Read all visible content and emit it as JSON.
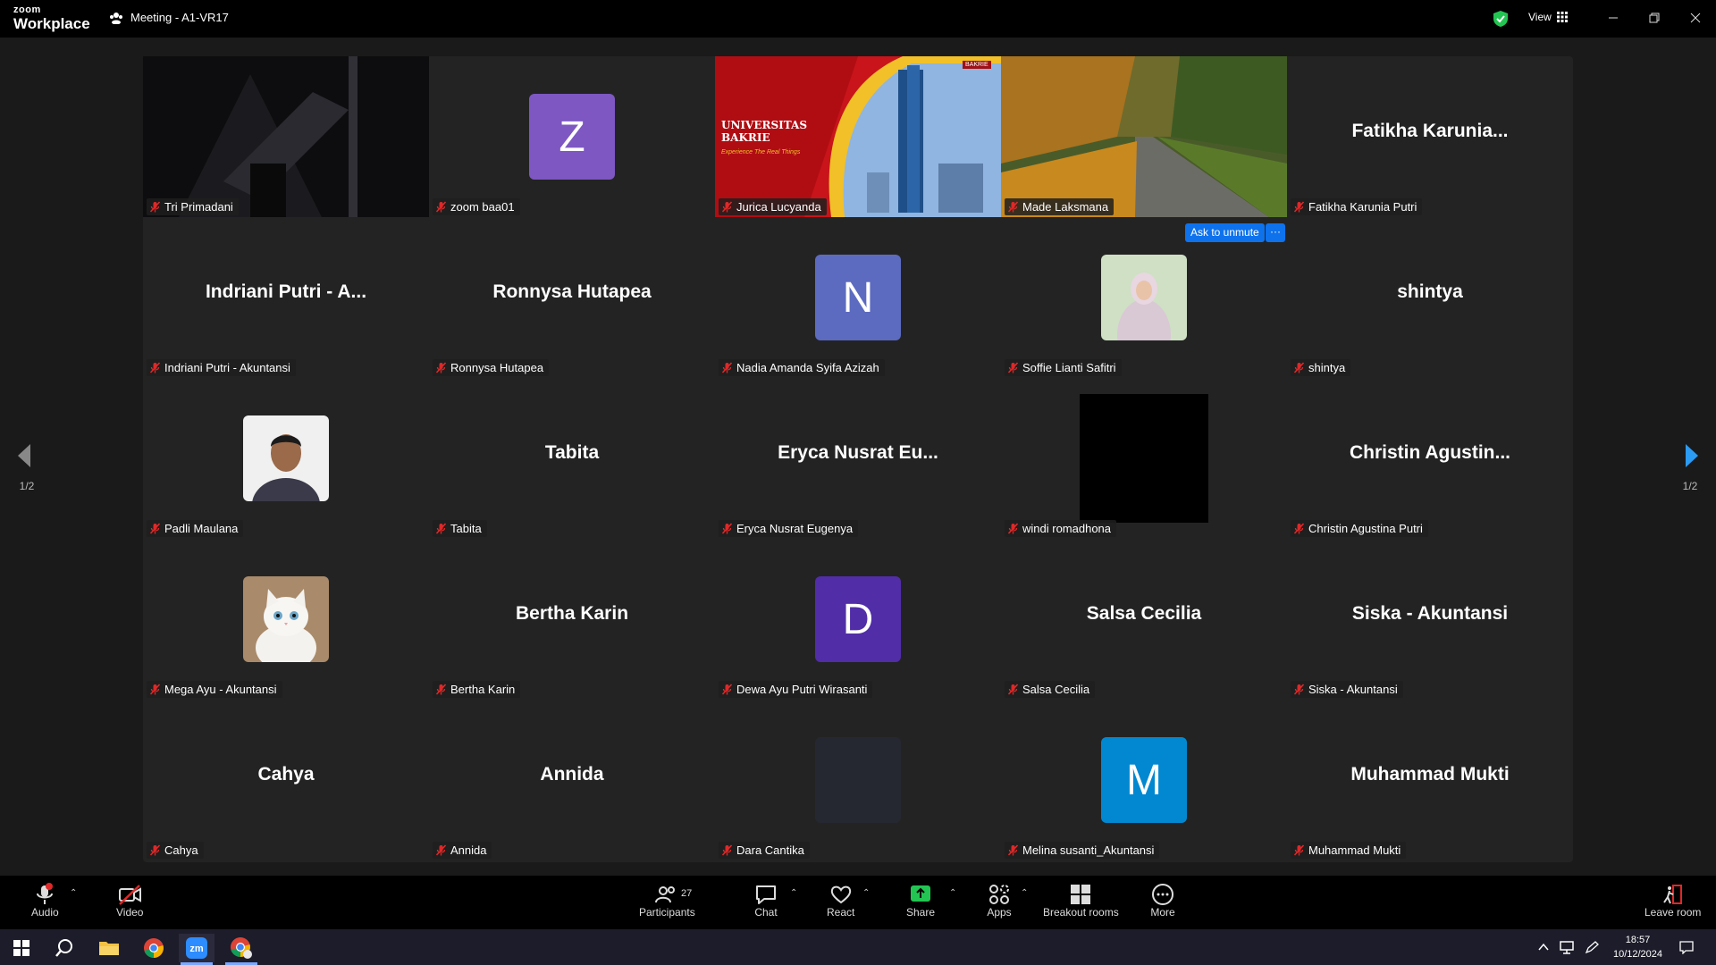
{
  "app": {
    "logo_top": "zoom",
    "logo_bottom": "Workplace",
    "meeting_title": "Meeting - A1-VR17",
    "view_label": "View"
  },
  "colors": {
    "accent": "#0e72ed",
    "highlight_border": "#23d18b",
    "mute_red": "#e02828"
  },
  "tiles": [
    {
      "display": "video",
      "name": "Tri Primadani"
    },
    {
      "display": "avatar",
      "avatar_letter": "Z",
      "avatar_color": "#7e57c2",
      "name": "zoom baa01"
    },
    {
      "display": "video-bakrie",
      "name": "Jurica Lucyanda",
      "banner_line1": "UNIVERSITAS",
      "banner_line2": "BAKRIE",
      "banner_tagline": "Experience The Real Things",
      "banner_badge": "BAKRIE"
    },
    {
      "display": "video-road",
      "name": "Made Laksmana"
    },
    {
      "display": "text",
      "center": "Fatikha  Karunia...",
      "name": "Fatikha Karunia Putri"
    },
    {
      "display": "text",
      "center": "Indriani Putri - A...",
      "name": "Indriani Putri - Akuntansi"
    },
    {
      "display": "text",
      "center": "Ronnysa Hutapea",
      "name": "Ronnysa Hutapea"
    },
    {
      "display": "avatar",
      "avatar_letter": "N",
      "avatar_color": "#5c6bc0",
      "name": "Nadia Amanda Syifa Azizah"
    },
    {
      "display": "photo-hijab",
      "name": "Soffie Lianti Safitri"
    },
    {
      "display": "text",
      "center": "shintya",
      "name": "shintya"
    },
    {
      "display": "photo-man",
      "name": "Padli Maulana"
    },
    {
      "display": "text",
      "center": "Tabita",
      "name": "Tabita"
    },
    {
      "display": "text",
      "center": "Eryca Nusrat Eu...",
      "name": "Eryca Nusrat Eugenya"
    },
    {
      "display": "black",
      "name": "windi romadhona"
    },
    {
      "display": "text",
      "center": "Christin  Agustin...",
      "name": "Christin Agustina Putri"
    },
    {
      "display": "photo-cat",
      "name": "Mega Ayu - Akuntansi"
    },
    {
      "display": "text",
      "center": "Bertha Karin",
      "name": "Bertha Karin"
    },
    {
      "display": "avatar",
      "avatar_letter": "D",
      "avatar_color": "#512da8",
      "name": "Dewa Ayu Putri Wirasanti"
    },
    {
      "display": "text",
      "center": "Salsa Cecilia",
      "name": "Salsa Cecilia"
    },
    {
      "display": "text",
      "center": "Siska - Akuntansi",
      "name": "Siska - Akuntansi"
    },
    {
      "display": "text",
      "center": "Cahya",
      "name": "Cahya"
    },
    {
      "display": "text",
      "center": "Annida",
      "name": "Annida"
    },
    {
      "display": "dark-avatar",
      "name": "Dara Cantika"
    },
    {
      "display": "avatar",
      "avatar_letter": "M",
      "avatar_color": "#0288d1",
      "name": "Melina susanti_Akuntansi"
    },
    {
      "display": "text",
      "center": "Muhammad Mukti",
      "name": "Muhammad Mukti"
    }
  ],
  "ask_to_unmute": "Ask to unmute",
  "more_dots": "···",
  "pager": {
    "left": "1/2",
    "right": "1/2"
  },
  "toolbar": {
    "audio": "Audio",
    "video": "Video",
    "participants": "Participants",
    "participants_count": "27",
    "chat": "Chat",
    "react": "React",
    "share": "Share",
    "apps": "Apps",
    "breakout": "Breakout rooms",
    "more": "More",
    "leave": "Leave room"
  },
  "taskbar": {
    "time": "18:57",
    "date": "10/12/2024"
  }
}
